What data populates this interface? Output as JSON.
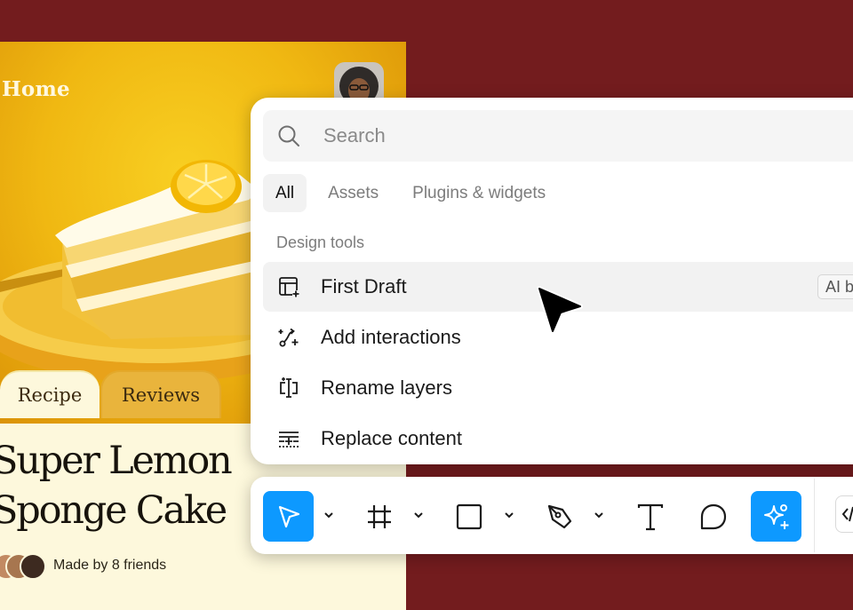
{
  "app": {
    "title": "Home",
    "tabs": [
      {
        "label": "Recipe",
        "selected": true
      },
      {
        "label": "Reviews",
        "selected": false
      }
    ],
    "recipe_title_line1": "Super Lemon",
    "recipe_title_line2": "Sponge Cake",
    "made_by": "Made by 8 friends"
  },
  "palette": {
    "search_placeholder": "Search",
    "filters": [
      {
        "label": "All",
        "active": true
      },
      {
        "label": "Assets",
        "active": false
      },
      {
        "label": "Plugins & widgets",
        "active": false
      }
    ],
    "section_label": "Design tools",
    "commands": [
      {
        "label": "First Draft",
        "icon": "first-draft-icon",
        "badge": "AI b",
        "hovered": true
      },
      {
        "label": "Add interactions",
        "icon": "interactions-icon"
      },
      {
        "label": "Rename layers",
        "icon": "rename-layers-icon"
      },
      {
        "label": "Replace content",
        "icon": "replace-content-icon"
      }
    ]
  },
  "toolbar": {
    "tools": [
      {
        "name": "move-tool",
        "icon": "pointer-icon",
        "active": true
      },
      {
        "name": "frame-tool",
        "icon": "frame-icon"
      },
      {
        "name": "shape-tool",
        "icon": "rectangle-icon"
      },
      {
        "name": "pen-tool",
        "icon": "pen-icon"
      },
      {
        "name": "text-tool",
        "icon": "text-icon"
      },
      {
        "name": "comment-tool",
        "icon": "comment-icon"
      },
      {
        "name": "ai-tool",
        "icon": "sparkle-icon",
        "active": true
      },
      {
        "name": "dev-mode-toggle",
        "icon": "code-icon"
      }
    ]
  },
  "colors": {
    "background": "#731c1e",
    "accent": "#0d99ff",
    "cream": "#fdf8dc",
    "reviews_tab": "#e9b43c"
  }
}
